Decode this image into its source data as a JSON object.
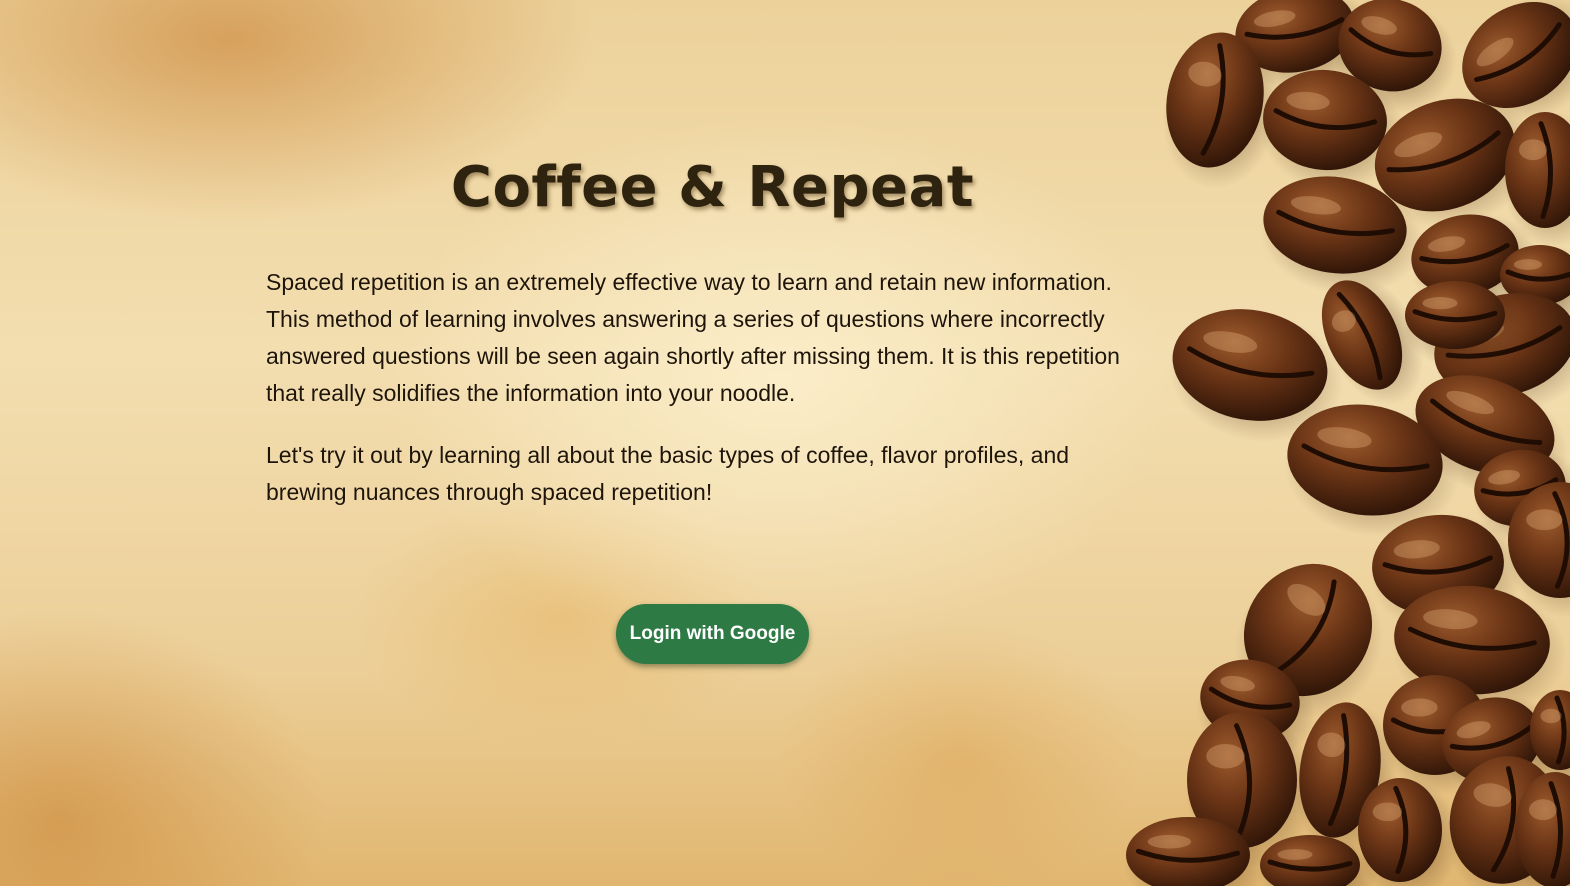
{
  "app": {
    "title": "Coffee & Repeat"
  },
  "intro": {
    "paragraph_1": "Spaced repetition is an extremely effective way to learn and retain new information. This method of learning involves answering a series of questions where incorrectly answered questions will be seen again shortly after missing them. It is this repetition that really solidifies the information into your noodle.",
    "paragraph_2": "Let's try it out by learning all about the basic types of coffee, flavor profiles, and brewing nuances through spaced repetition!"
  },
  "actions": {
    "login_label": "Login with Google"
  },
  "colors": {
    "button_background": "#2e7a45",
    "title_text": "#2e230f",
    "body_text": "#1e1408",
    "bean_dark": "#3a1c0b",
    "bean_mid": "#6b3516"
  },
  "decor": {
    "background": "aged-paper-texture",
    "side_image": "coffee-beans"
  }
}
